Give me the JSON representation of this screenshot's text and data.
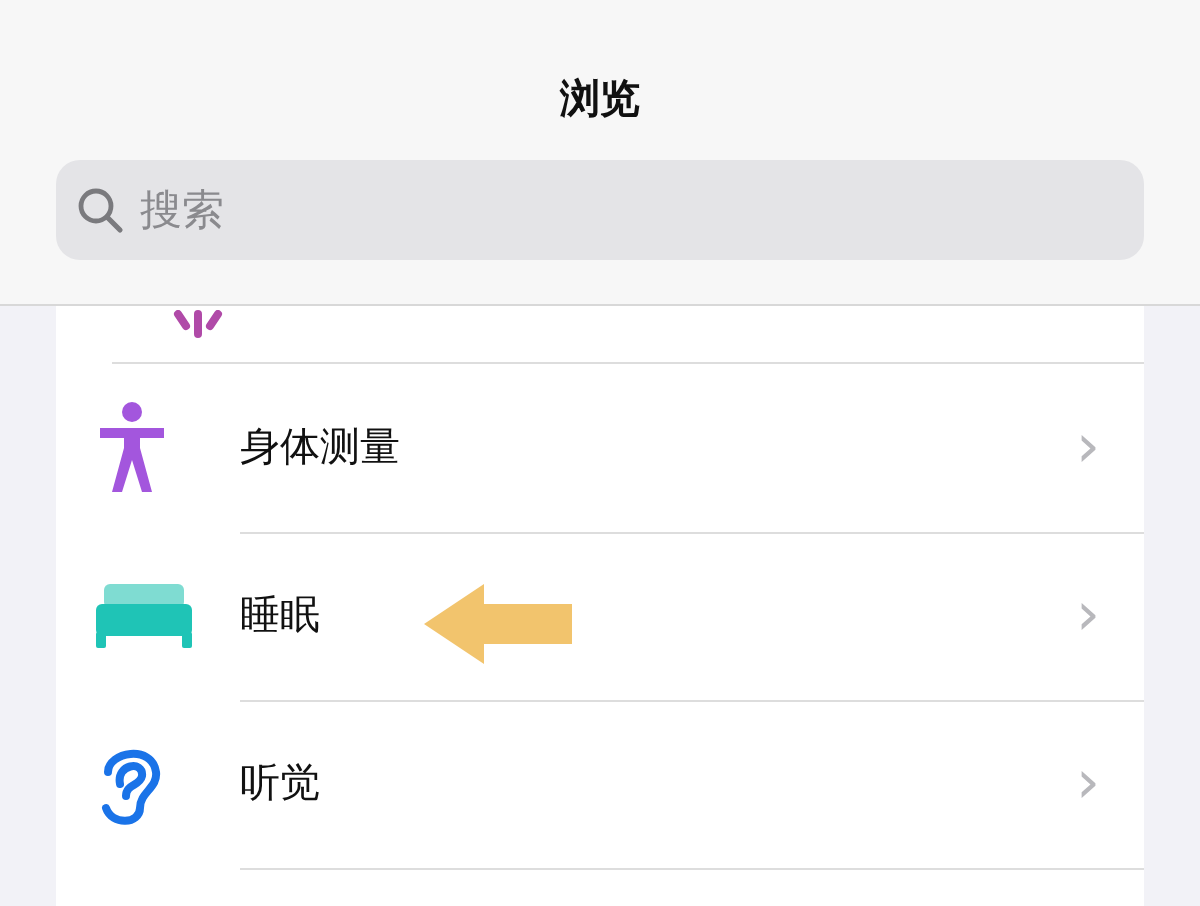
{
  "nav": {
    "title": "浏览"
  },
  "search": {
    "placeholder": "搜索"
  },
  "categories": [
    {
      "kind": "body",
      "label": "身体测量",
      "chevron": "›",
      "pointed": false
    },
    {
      "kind": "sleep",
      "label": "睡眠",
      "chevron": "›",
      "pointed": true
    },
    {
      "kind": "hearing",
      "label": "听觉",
      "chevron": "›",
      "pointed": false
    }
  ]
}
